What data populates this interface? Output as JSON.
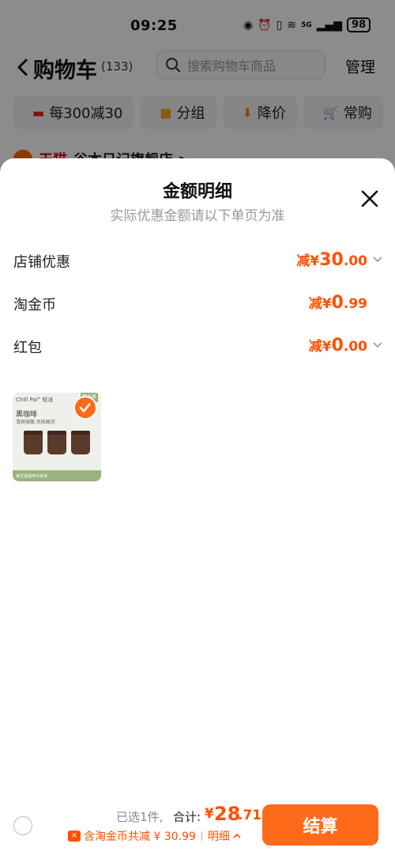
{
  "status_bar": {
    "time": "09:25",
    "network": "5G",
    "battery": "98"
  },
  "header": {
    "title": "购物车",
    "count": "(133)",
    "search_placeholder": "搜索购物车商品",
    "manage": "管理"
  },
  "filter_chips": [
    {
      "label": "每300减30",
      "icon": "shop-icon"
    },
    {
      "label": "分组",
      "icon": "folder-icon"
    },
    {
      "label": "降价",
      "icon": "down-arrow-icon"
    },
    {
      "label": "常购",
      "icon": "cart-icon"
    }
  ],
  "shop": {
    "tag": "天猫",
    "name": "谷本日记旗舰店 >"
  },
  "sheet": {
    "title": "金额明细",
    "subtitle": "实际优惠金额请以下单页为准",
    "rows": [
      {
        "label": "店铺优惠",
        "prefix": "减¥",
        "integer": "30",
        "decimal": ".00",
        "has_chevron": true
      },
      {
        "label": "淘金币",
        "prefix": "减¥",
        "integer": "0",
        "decimal": ".99",
        "has_chevron": false
      },
      {
        "label": "红包",
        "prefix": "减¥",
        "integer": "0",
        "decimal": ".00",
        "has_chevron": true
      }
    ],
    "product": {
      "brand": "Chill Pai° 轻派",
      "tag": "精选推荐",
      "name": "黑咖啡",
      "desc": "清爽微酸 风味醇浓",
      "footer": "美式黑咖啡冷萃液"
    }
  },
  "bottom_bar": {
    "selected": "已选1件,",
    "total_label": "合计:",
    "currency": "¥",
    "total_integer": "28",
    "total_decimal": ".71",
    "discount_text": "含淘金币共减 ¥ 30.99",
    "detail_label": "明细",
    "checkout_label": "结算"
  },
  "colors": {
    "accent": "#ff5000",
    "button": "#ff6a1a"
  }
}
